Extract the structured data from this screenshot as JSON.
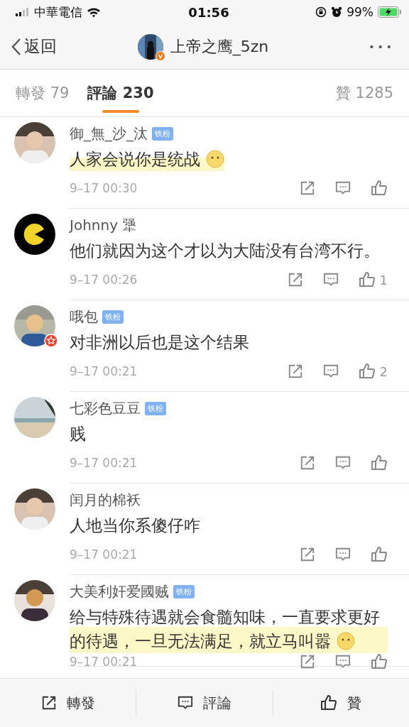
{
  "status_bar": {
    "carrier": "中華電信",
    "time": "01:56",
    "battery": "99%"
  },
  "nav": {
    "back": "返回",
    "title": "上帝之鹰_5zn",
    "more": "•••"
  },
  "tabs": [
    {
      "label": "轉發",
      "count": "79",
      "selected": false
    },
    {
      "label": "評論",
      "count": "230",
      "selected": true
    },
    {
      "label": "贊",
      "count": "1285",
      "selected": false
    }
  ],
  "comments": [
    {
      "name": "御_無_沙_汰",
      "fan_badge": "铁粉",
      "text": "人家会说你是统战",
      "emoji": true,
      "highlighted": true,
      "star_badge": false,
      "time": "9–17 00:30"
    },
    {
      "name": "Johnny 犟",
      "text": "他们就因为这个才以为大陆没有台湾不行。",
      "emoji": false,
      "highlighted": false,
      "star_badge": false,
      "time": "9–17 00:26",
      "likes": "1"
    },
    {
      "name": "哦包",
      "fan_badge": "铁粉",
      "text": "对非洲以后也是这个结果",
      "emoji": false,
      "highlighted": false,
      "star_badge": true,
      "time": "9–17 00:21",
      "likes": "2"
    },
    {
      "name": "七彩色豆豆",
      "fan_badge": "铁粉",
      "text": "贱",
      "emoji": false,
      "highlighted": false,
      "star_badge": false,
      "time": "9–17 00:21"
    },
    {
      "name": "闰月的棉袄",
      "text": "人地当你系傻仔咋",
      "emoji": false,
      "highlighted": false,
      "star_badge": false,
      "time": "9–17 00:21"
    },
    {
      "name": "大美利奸爱國贼",
      "fan_badge": "铁粉",
      "text": "给与特殊待遇就会食髓知味，一直要求更好的待遇，一旦无法满足，就立马叫嚣",
      "emoji": true,
      "highlighted": true,
      "star_badge": false,
      "time": "9–17 00:21"
    }
  ],
  "bottom_bar": [
    {
      "kind": "repost",
      "label": "轉發"
    },
    {
      "kind": "comment",
      "label": "評論"
    },
    {
      "kind": "like",
      "label": "贊"
    }
  ]
}
